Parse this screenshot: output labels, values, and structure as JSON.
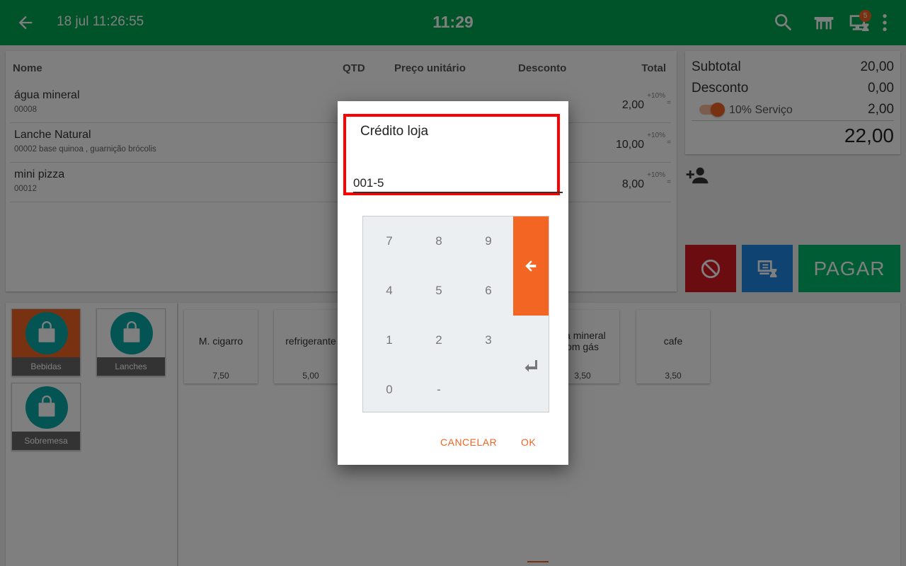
{
  "header": {
    "datetime": "18 jul 11:26:55",
    "clock": "11:29",
    "badge_count": "5"
  },
  "order": {
    "columns": {
      "name": "Nome",
      "qty": "QTD",
      "unit_price": "Preço unitário",
      "discount": "Desconto",
      "total": "Total"
    },
    "items": [
      {
        "name": "água mineral",
        "code": "00008",
        "total": "2,00",
        "service": "+10%",
        "eq": "="
      },
      {
        "name": "Lanche Natural",
        "code": "00002  base quinoa , guarnição brócolis",
        "total": "10,00",
        "service": "+10%",
        "eq": "="
      },
      {
        "name": "mini pizza",
        "code": "00012",
        "total": "8,00",
        "service": "+10%",
        "eq": "="
      }
    ]
  },
  "summary": {
    "subtotal_label": "Subtotal",
    "subtotal_value": "20,00",
    "discount_label": "Desconto",
    "discount_value": "0,00",
    "service_label": "10% Serviço",
    "service_value": "2,00",
    "total": "22,00"
  },
  "actions": {
    "pay_label": "PAGAR"
  },
  "categories": [
    {
      "label": "Bebidas"
    },
    {
      "label": "Lanches"
    },
    {
      "label": "Sobremesa"
    }
  ],
  "products": [
    {
      "name": "M. cigarro",
      "price": "7,50"
    },
    {
      "name": "refrigerante",
      "price": "5,00"
    },
    {
      "name": "ua mineral",
      "name2": "om gás",
      "price": "3,50"
    },
    {
      "name": "cafe",
      "price": "3,50"
    }
  ],
  "dialog": {
    "title": "Crédito loja",
    "value": "001-5",
    "keys": [
      "7",
      "8",
      "9",
      "4",
      "5",
      "6",
      "1",
      "2",
      "3",
      "0",
      "-"
    ],
    "cancel_label": "CANCELAR",
    "ok_label": "OK"
  },
  "colors": {
    "header": "#00a651",
    "accent": "#f26522",
    "cancel": "#d71920",
    "hold": "#1e88e5",
    "pay": "#00b86b",
    "category_circle": "#0aa8a8",
    "highlight": "#ff0000"
  }
}
